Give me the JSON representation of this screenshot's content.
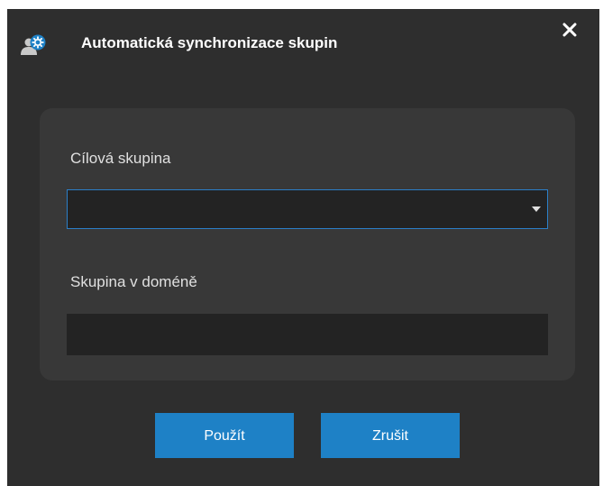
{
  "dialog": {
    "title": "Automatická synchronizace skupin",
    "title_icon": "group-sync-icon",
    "close_icon": "close-icon"
  },
  "form": {
    "target_group_label": "Cílová skupina",
    "target_group_value": "",
    "domain_group_label": "Skupina v doméně",
    "domain_group_value": ""
  },
  "buttons": {
    "apply_label": "Použít",
    "cancel_label": "Zrušit"
  },
  "colors": {
    "dialog_background": "#2e2e2e",
    "panel_background": "#383838",
    "field_background": "#232323",
    "accent": "#1e81c6",
    "focus_border": "#2b7fc8"
  }
}
